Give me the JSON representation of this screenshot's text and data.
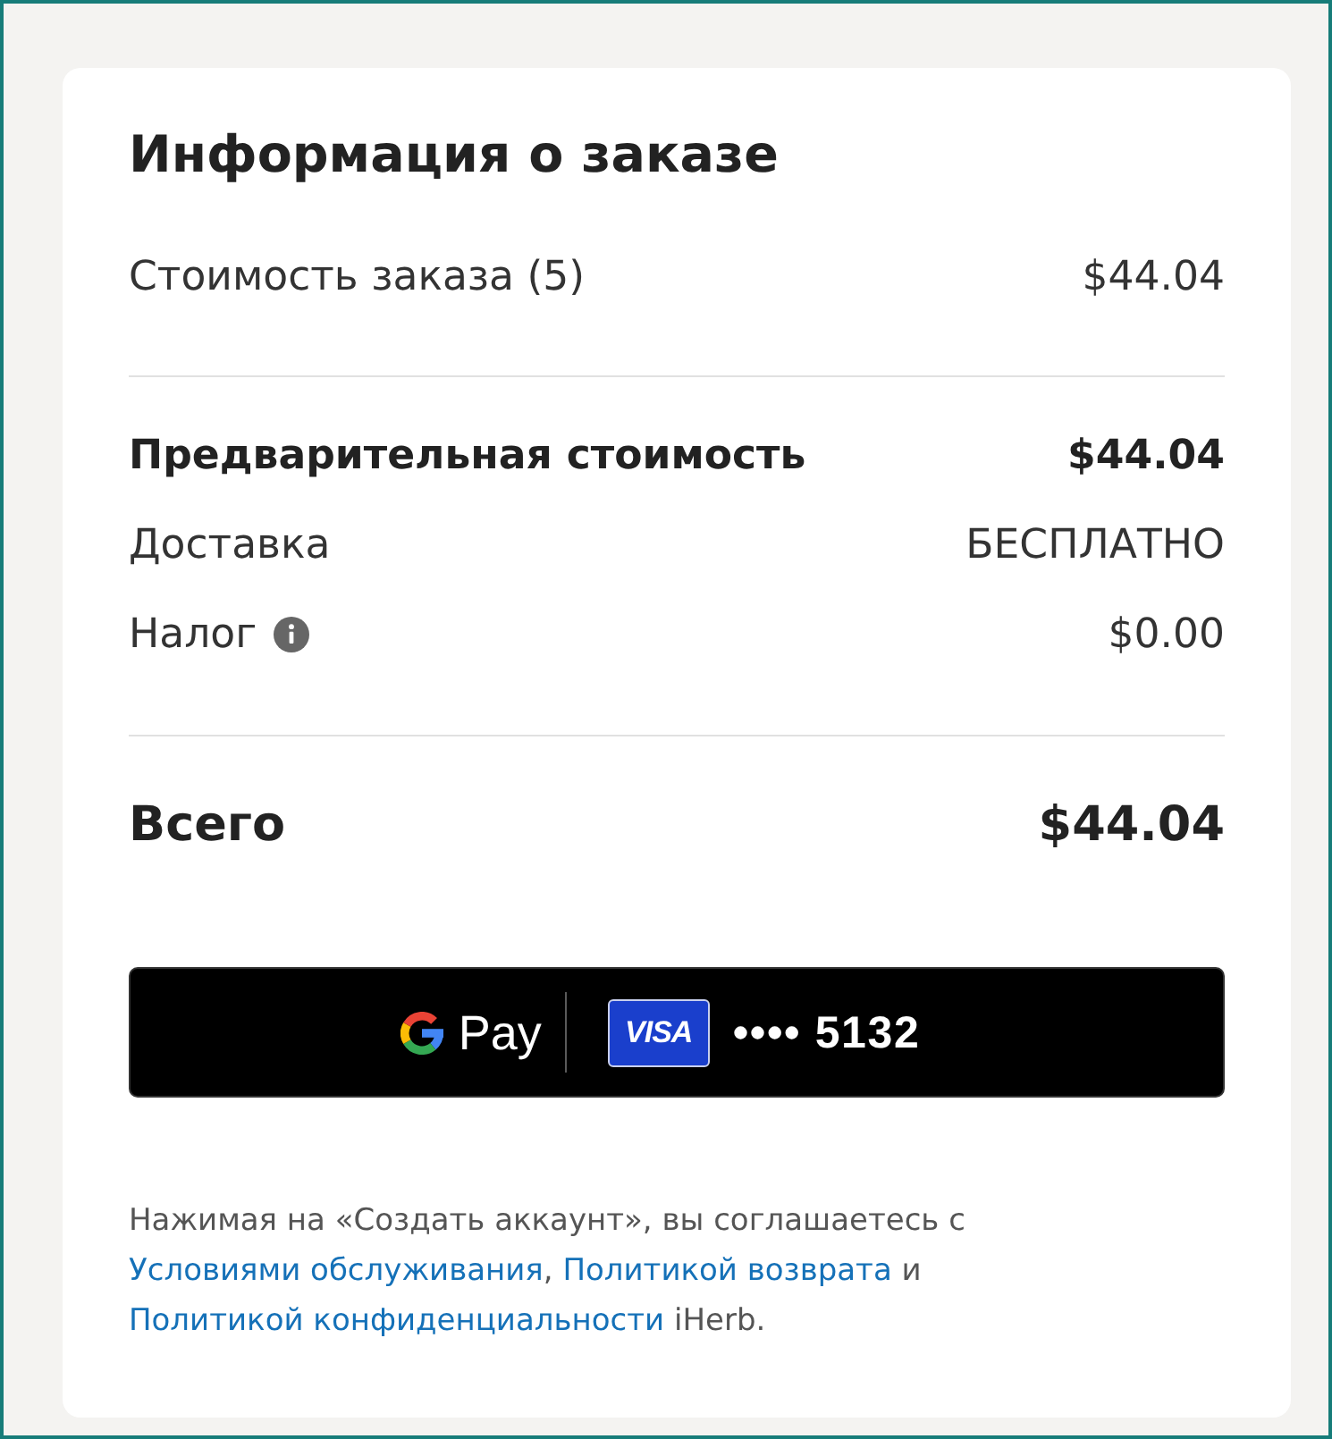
{
  "order_summary": {
    "title": "Информация о заказе",
    "items": [
      {
        "label": "Стоимость заказа (5)",
        "value": "$44.04"
      }
    ],
    "subtotal": {
      "label": "Предварительная стоимость",
      "value": "$44.04"
    },
    "charges": [
      {
        "label": "Доставка",
        "value": "БЕСПЛАТНО",
        "info": false
      },
      {
        "label": "Налог",
        "value": "$0.00",
        "info": true
      }
    ],
    "total": {
      "label": "Всего",
      "value": "$44.04"
    }
  },
  "payment_button": {
    "label": "Pay",
    "card_brand": "VISA",
    "card_number": "•••• 5132"
  },
  "terms": [
    {
      "kind": "text",
      "text": "Нажимая на «Создать аккаунт», вы соглашаетесь с "
    },
    {
      "kind": "link",
      "text": "Условиями обслуживания"
    },
    {
      "kind": "text",
      "text": ", "
    },
    {
      "kind": "link",
      "text": "Политикой возврата"
    },
    {
      "kind": "text",
      "text": " и "
    },
    {
      "kind": "link",
      "text": "Политикой конфиденциальности"
    },
    {
      "kind": "text",
      "text": " iHerb."
    }
  ]
}
